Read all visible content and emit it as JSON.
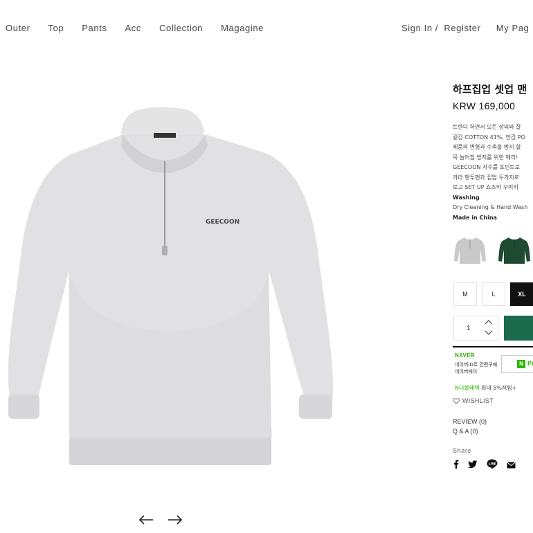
{
  "nav": {
    "left_items": [
      "Outer",
      "Top",
      "Pants",
      "Acc",
      "Collection",
      "Magagine"
    ],
    "sign_in": "Sign In",
    "separator": "/",
    "register": "Register",
    "my_page": "My Pag"
  },
  "product": {
    "title": "하프집업 셋업 맨",
    "price": "KRW 169,000",
    "image_logo_text": "GEECOON",
    "description_lines": [
      "트렌디 하면서 모든 상의와 잘",
      "겉감 COTTON 41%, 안감 PO",
      "제품의 변형과 수축을 방지 할",
      "목 늘어짐 방지를 위한 헤리!",
      "GEECOON 자수를 포인트로",
      "카라 맨투맨과 집업 두가지로",
      "로고 SET UP 쇼즈와 꾸미지"
    ],
    "washing_label": "Washing",
    "washing_value": "Dry Cleaning & Hand Wash",
    "origin": "Made in China"
  },
  "colors": {
    "accent_green": "#1d6b4f",
    "naver_green": "#2db400",
    "swatch_gray": "#c9c9c9",
    "swatch_green": "#1e4a32"
  },
  "sizes": [
    "M",
    "L",
    "XL"
  ],
  "selected_size": "XL",
  "quantity": "1",
  "naver": {
    "logo": "NAVER",
    "line1": "네이버ID로 간편구매",
    "line2": "네이버페이",
    "button_n": "N",
    "button_pay": "Pa"
  },
  "benefit": {
    "highlight": "N더블혜택",
    "prefix": "",
    "rest": " 최대 5%적립+"
  },
  "wishlist": "WISHLIST",
  "review": "REVIEW (0)",
  "qa": "Q & A (0)",
  "share": {
    "label": "Share",
    "icons": [
      "facebook-icon",
      "twitter-icon",
      "line-icon",
      "email-icon"
    ]
  }
}
